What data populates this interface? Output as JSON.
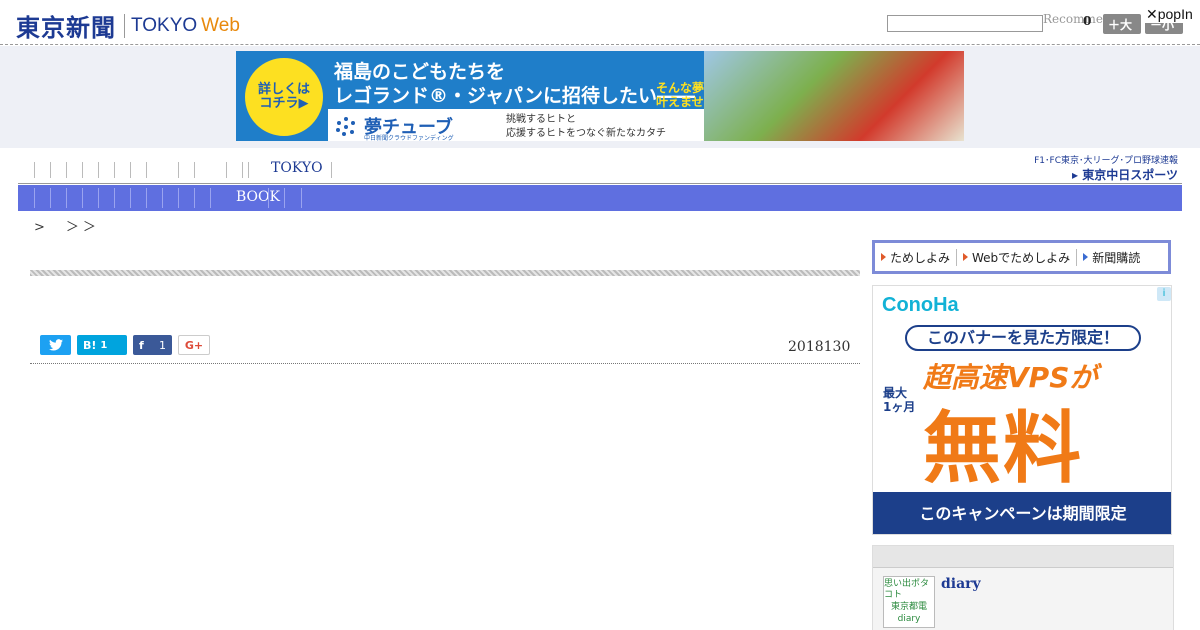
{
  "header": {
    "logo_jp": "東京新聞",
    "logo_en": "TOKYO",
    "logo_web": "Web",
    "search_placeholder": "",
    "recommend_label": "Recommen",
    "recommend_count": "0",
    "font_large": "＋大",
    "font_small": "－小",
    "popin_label": "✕popIn"
  },
  "top_ad": {
    "circle_line1": "詳しくは",
    "circle_line2": "コチラ▶",
    "line1": "福島のこどもたちを",
    "line2": "レゴランド®・ジャパンに招待したい――",
    "side_line1": "そんな夢を一緒に",
    "side_line2": "叶えませんか？",
    "brand": "夢チューブ",
    "brand_sub": "中日新聞クラウドファンディング",
    "tag_line1": "挑戦するヒトと",
    "tag_line2": "応援するヒトをつなぐ新たなカタチ"
  },
  "nav": {
    "primary_label": "TOKYO",
    "secondary_label": "BOOK",
    "chunichi_top": "F1･FC東京･大リーグ･プロ野球速報",
    "chunichi_bottom": "▸ 東京中日スポーツ"
  },
  "breadcrumb": ">　＞＞",
  "article": {
    "share": {
      "twitter_icon": "twitter-bird",
      "hatena_label": "B!",
      "hatena_count": "1",
      "facebook_label": "f",
      "facebook_count": "1",
      "gplus_label": "G+"
    },
    "date": "2018130"
  },
  "sidebar": {
    "paper_nav": [
      {
        "label": "ためしよみ"
      },
      {
        "label": "Webでためしよみ"
      },
      {
        "label": "新聞購読"
      }
    ],
    "ad": {
      "logo": "ConoHa",
      "info": "i",
      "pill": "このバナーを見た方限定！",
      "vps": "超高速VPSが",
      "side_line1": "最大",
      "side_line2": "1ヶ月",
      "big": "無料",
      "foot": "このキャンペーンは期間限定"
    },
    "diary": {
      "thumb_line1": "思い出ポタコト",
      "thumb_line2": "東京都電",
      "thumb_line3": "diary",
      "title": "diary"
    }
  },
  "colors": {
    "brand_blue": "#1d3a93",
    "web_orange": "#e8890c",
    "nav_bar": "#5f6fe0",
    "ad_band_bg": "#eef0f6"
  }
}
